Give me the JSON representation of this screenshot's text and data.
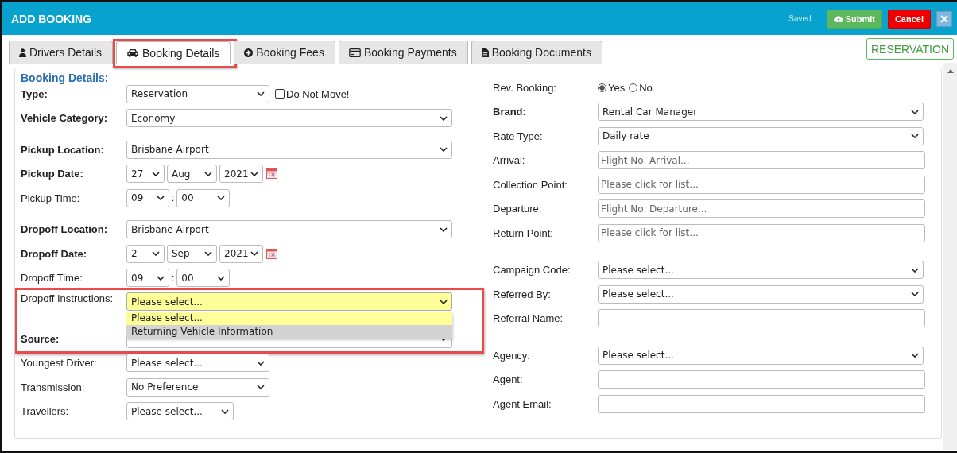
{
  "window": {
    "title": "ADD BOOKING",
    "status": "Saved",
    "buttons": [
      {
        "kind": "submit",
        "label": "Submit"
      },
      {
        "kind": "cancel",
        "label": "Cancel"
      },
      {
        "kind": "close"
      }
    ]
  },
  "tabs": [
    {
      "kind": "user",
      "label": "Drivers Details",
      "selected": false,
      "highlighted": false
    },
    {
      "kind": "car",
      "label": "Booking Details",
      "selected": true,
      "highlighted": true
    },
    {
      "kind": "plus",
      "label": "Booking Fees",
      "selected": false,
      "highlighted": false
    },
    {
      "kind": "card",
      "label": "Booking Payments",
      "selected": false,
      "highlighted": false
    },
    {
      "kind": "file",
      "label": "Booking Documents",
      "selected": false,
      "highlighted": false
    }
  ],
  "badge": "RESERVATION",
  "form": {
    "heading": "Booking Details:",
    "left": [
      {
        "kind": "plain",
        "rows": [
          {
            "label": "Type:",
            "bold": true,
            "kind": "compact",
            "value": "Reservation",
            "checkbox": {
              "label": "Do Not Move!",
              "checked": false
            }
          },
          {
            "label": "Vehicle Category:",
            "bold": true,
            "kind": "select",
            "value": "Economy"
          }
        ]
      },
      {
        "kind": "spaced",
        "rows": [
          {
            "label": "Pickup Location:",
            "bold": true,
            "kind": "select",
            "value": "Brisbane Airport"
          },
          {
            "label": "Pickup Date:",
            "bold": true,
            "kind": "date",
            "parts": [
              "27",
              "Aug",
              "2021"
            ]
          },
          {
            "label": "Pickup Time:",
            "bold": false,
            "kind": "time",
            "parts": [
              "09",
              "00"
            ],
            "separator": ":"
          }
        ]
      },
      {
        "kind": "spaced",
        "rows": [
          {
            "label": "Dropoff Location:",
            "bold": true,
            "kind": "select",
            "value": "Brisbane Airport"
          },
          {
            "label": "Dropoff Date:",
            "bold": true,
            "kind": "date",
            "parts": [
              "2",
              "Sep",
              "2021"
            ]
          },
          {
            "label": "Dropoff Time:",
            "bold": false,
            "kind": "time",
            "parts": [
              "09",
              "00"
            ],
            "separator": ":"
          }
        ]
      },
      {
        "kind": "framed",
        "rows": [
          {
            "label": "Dropoff Instructions:",
            "bold": false,
            "kind": "select",
            "value": "Please select...",
            "focused": true,
            "open": true,
            "options": [
              {
                "label": "Please select...",
                "selected": true
              },
              {
                "label": "Returning Vehicle Information",
                "selected": false
              }
            ]
          },
          {
            "label": "Source:",
            "bold": true,
            "kind": "select"
          }
        ]
      },
      {
        "kind": "plain",
        "rows": [
          {
            "label": "Youngest Driver:",
            "bold": false,
            "kind": "compact",
            "value": "Please select..."
          },
          {
            "label": "Transmission:",
            "bold": false,
            "kind": "compact",
            "value": "No Preference"
          },
          {
            "label": "Travellers:",
            "bold": false,
            "kind": "narrow",
            "value": "Please select..."
          }
        ]
      }
    ],
    "right": [
      {
        "kind": "plain",
        "rows": [
          {
            "label": "Rev. Booking:",
            "bold": false,
            "kind": "radio",
            "options": [
              {
                "label": "Yes",
                "selected": true
              },
              {
                "label": "No",
                "selected": false
              }
            ]
          },
          {
            "label": "Brand:",
            "bold": true,
            "kind": "select",
            "value": "Rental Car Manager"
          },
          {
            "label": "Rate Type:",
            "bold": false,
            "kind": "select",
            "value": "Daily rate"
          },
          {
            "label": "Arrival:",
            "bold": false,
            "kind": "input",
            "placeholder": "Flight No. Arrival..."
          },
          {
            "label": "Collection Point:",
            "bold": false,
            "kind": "input",
            "placeholder": "Please click for list..."
          },
          {
            "label": "Departure:",
            "bold": false,
            "kind": "input",
            "placeholder": "Flight No. Departure..."
          },
          {
            "label": "Return Point:",
            "bold": false,
            "kind": "input",
            "placeholder": "Please click for list..."
          }
        ]
      },
      {
        "kind": "spaced",
        "rows": [
          {
            "label": "Campaign Code:",
            "bold": false,
            "kind": "select",
            "value": "Please select..."
          },
          {
            "label": "Referred By:",
            "bold": false,
            "kind": "select",
            "value": "Please select..."
          },
          {
            "label": "Referral Name:",
            "bold": false,
            "kind": "input"
          }
        ]
      },
      {
        "kind": "spaced",
        "rows": [
          {
            "label": "Agency:",
            "bold": false,
            "kind": "select",
            "value": "Please select..."
          },
          {
            "label": "Agent:",
            "bold": false,
            "kind": "input"
          },
          {
            "label": "Agent Email:",
            "bold": false,
            "kind": "input"
          }
        ]
      }
    ]
  }
}
